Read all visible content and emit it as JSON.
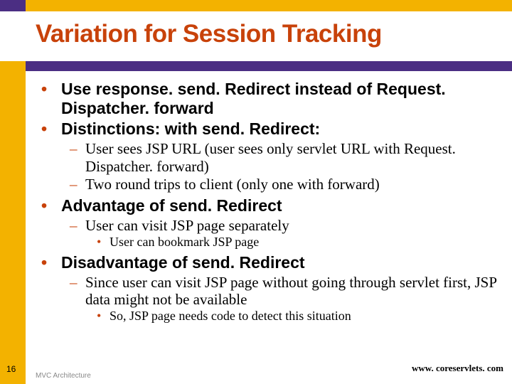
{
  "title": "Variation for Session Tracking",
  "bullets": {
    "a1": "Use response. send. Redirect instead of Request. Dispatcher. forward",
    "a2": "Distinctions: with send. Redirect:",
    "a2_1": "User sees JSP URL (user sees only servlet URL with Request. Dispatcher. forward)",
    "a2_2": "Two round trips to client (only one with forward)",
    "a3": "Advantage of send. Redirect",
    "a3_1": "User can visit JSP page separately",
    "a3_1_1": "User can bookmark JSP page",
    "a4": "Disadvantage of send. Redirect",
    "a4_1": "Since user can visit JSP page without going through servlet first, JSP data might not be available",
    "a4_1_1": "So, JSP page needs code to detect this situation"
  },
  "footer": {
    "page": "16",
    "mid": "MVC Architecture",
    "url": "www. coreservlets. com"
  }
}
